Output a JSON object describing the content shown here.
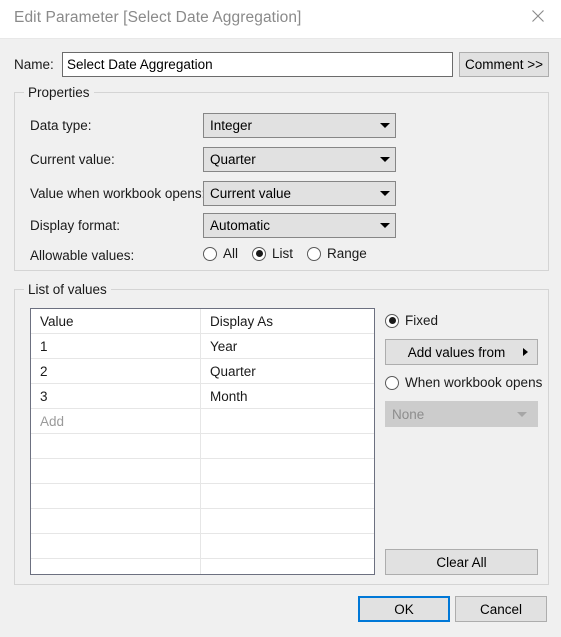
{
  "window": {
    "title": "Edit Parameter [Select Date Aggregation]",
    "close_icon": "close-icon"
  },
  "name_row": {
    "label": "Name:",
    "value": "Select Date Aggregation",
    "comment_button": "Comment >>"
  },
  "properties": {
    "group_title": "Properties",
    "rows": [
      {
        "label": "Data type:",
        "value": "Integer"
      },
      {
        "label": "Current value:",
        "value": "Quarter"
      },
      {
        "label": "Value when workbook opens:",
        "value": "Current value"
      },
      {
        "label": "Display format:",
        "value": "Automatic"
      }
    ],
    "allowable": {
      "label": "Allowable values:",
      "options": [
        {
          "label": "All",
          "selected": false
        },
        {
          "label": "List",
          "selected": true
        },
        {
          "label": "Range",
          "selected": false
        }
      ]
    }
  },
  "list_of_values": {
    "group_title": "List of values",
    "columns": [
      "Value",
      "Display As"
    ],
    "rows": [
      {
        "value": "1",
        "display_as": "Year"
      },
      {
        "value": "2",
        "display_as": "Quarter"
      },
      {
        "value": "3",
        "display_as": "Month"
      }
    ],
    "add_row_placeholder": "Add",
    "empty_row_count": 6,
    "source": {
      "fixed": {
        "label": "Fixed",
        "selected": true
      },
      "add_values_from": "Add values from",
      "when_workbook_opens": {
        "label": "When workbook opens",
        "selected": false
      },
      "workbook_field": "None"
    },
    "clear_all": "Clear All"
  },
  "footer": {
    "ok": "OK",
    "cancel": "Cancel"
  },
  "colors": {
    "accent": "#0078D7",
    "dialog_bg": "#F0F0F0",
    "button_bg": "#E1E1E1",
    "title_text": "#8A8A8A"
  }
}
